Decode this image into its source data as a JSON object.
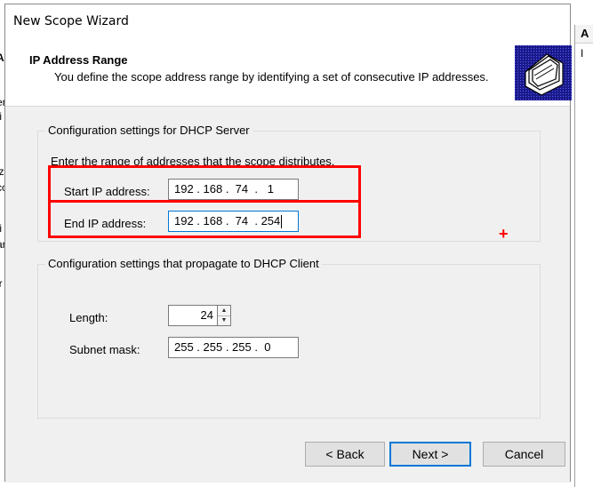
{
  "background_fragments": {
    "left_chars": [
      "A",
      "er",
      "ti",
      "iz",
      "co",
      "ti",
      "ar",
      "ir"
    ],
    "right_header": "A",
    "right_row": "I"
  },
  "dialog": {
    "title": "New Scope Wizard",
    "header": {
      "title": "IP Address Range",
      "description": "You define the scope address range by identifying a set of consecutive IP addresses.",
      "icon": "folders-icon"
    },
    "dhcp_server_group": {
      "label": "Configuration settings for DHCP Server",
      "instruction": "Enter the range of addresses that the scope distributes.",
      "start_ip": {
        "label": "Start IP address:",
        "value": "192 . 168 .  74  .   1"
      },
      "end_ip": {
        "label": "End IP address:",
        "value": "192 . 168 .  74  . 254"
      }
    },
    "dhcp_client_group": {
      "label": "Configuration settings that propagate to DHCP Client",
      "length": {
        "label": "Length:",
        "value": "24"
      },
      "subnet_mask": {
        "label": "Subnet mask:",
        "value": "255 . 255 . 255 .  0"
      }
    },
    "buttons": {
      "back": "< Back",
      "next": "Next >",
      "cancel": "Cancel"
    }
  },
  "annotations": {
    "highlight_color": "#ff0000",
    "marker": "+"
  }
}
